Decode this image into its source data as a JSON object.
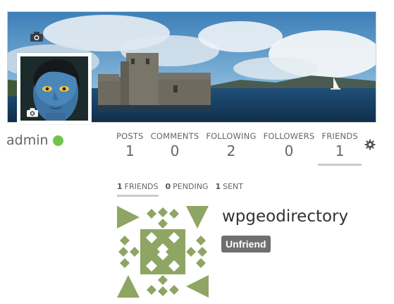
{
  "profile": {
    "username": "admin",
    "online_color": "#6fc44a",
    "cover_camera_icon": "camera-icon",
    "avatar_camera_icon": "camera-icon"
  },
  "stats": [
    {
      "label": "POSTS",
      "value": "1"
    },
    {
      "label": "COMMENTS",
      "value": "0"
    },
    {
      "label": "FOLLOWING",
      "value": "2"
    },
    {
      "label": "FOLLOWERS",
      "value": "0"
    },
    {
      "label": "FRIENDS",
      "value": "1"
    }
  ],
  "active_stat": "FRIENDS",
  "settings_icon": "gear-icon",
  "subtabs": [
    {
      "count": "1",
      "label": "FRIENDS"
    },
    {
      "count": "0",
      "label": "PENDING"
    },
    {
      "count": "1",
      "label": "SENT"
    }
  ],
  "friend": {
    "name": "wpgeodirectory",
    "action_label": "Unfriend",
    "identicon_color": "#8fa564"
  }
}
